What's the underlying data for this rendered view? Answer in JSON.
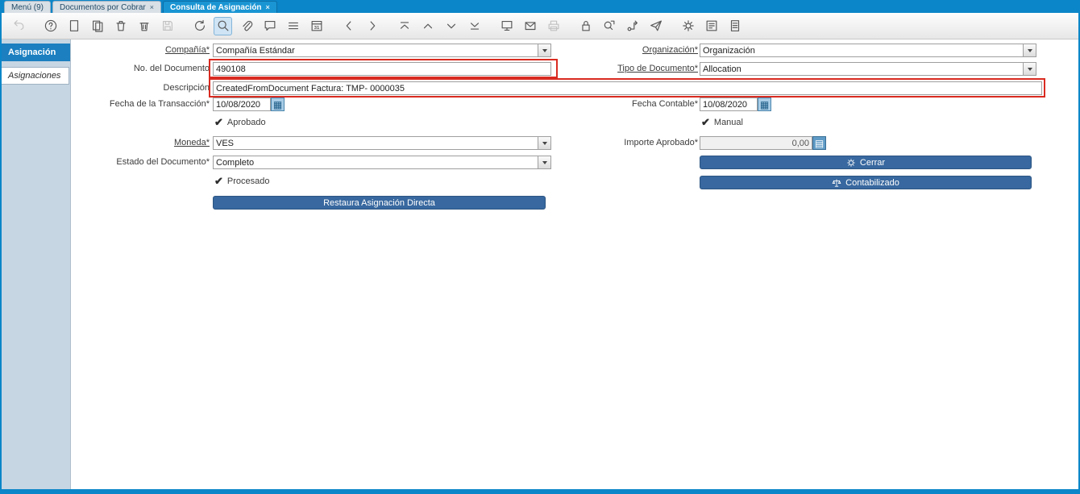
{
  "tabbar": {
    "tabs": [
      {
        "label": "Menú (9)"
      },
      {
        "label": "Documentos por Cobrar"
      },
      {
        "label": "Consulta de Asignación"
      }
    ],
    "close_glyph": "×"
  },
  "toolbar": {
    "icons": [
      "undo",
      "help",
      "new-record",
      "copy-record",
      "delete-record",
      "delete-selection",
      "save",
      "refresh",
      "find",
      "attachment",
      "chat",
      "grid-toggle",
      "calendar",
      "previous-tab",
      "next-tab",
      "first-record",
      "previous-record",
      "next-record",
      "last-record",
      "requests",
      "archive",
      "print",
      "private-record-lock",
      "zoom-across",
      "workflow",
      "send-mail",
      "preferences",
      "export",
      "report"
    ],
    "calendar_number": "31"
  },
  "sidebar": {
    "tabs": [
      {
        "label": "Asignación"
      },
      {
        "label": "Asignaciones"
      }
    ]
  },
  "form": {
    "company": {
      "label": "Compañía*",
      "value": "Compañía Estándar"
    },
    "organization": {
      "label": "Organización*",
      "value": "Organización"
    },
    "document_no": {
      "label": "No. del Documento",
      "value": "490108"
    },
    "document_type": {
      "label": "Tipo de Documento*",
      "value": "Allocation"
    },
    "description": {
      "label": "Descripción",
      "value": "CreatedFromDocument Factura: TMP- 0000035"
    },
    "transaction_date": {
      "label": "Fecha de la Transacción*",
      "value": "10/08/2020"
    },
    "accounting_date": {
      "label": "Fecha Contable*",
      "value": "10/08/2020"
    },
    "approved": {
      "label": "Aprobado",
      "checked": true
    },
    "manual": {
      "label": "Manual",
      "checked": true
    },
    "currency": {
      "label": "Moneda*",
      "value": "VES"
    },
    "approved_amount": {
      "label": "Importe Aprobado*",
      "value": "0,00"
    },
    "document_status": {
      "label": "Estado del Documento*",
      "value": "Completo"
    },
    "processed": {
      "label": "Procesado",
      "checked": true
    },
    "buttons": {
      "close": "Cerrar",
      "posted": "Contabilizado",
      "restore": "Restaura Asignación Directa"
    },
    "check_glyph": "✔",
    "calendar_button_glyph": "▦",
    "calculator_button_glyph": "▤"
  },
  "colors": {
    "accent_blue": "#0b86c8",
    "active_tab_blue": "#1a95d3",
    "sidebar_tab_blue": "#1b7fc0",
    "button_blue": "#38689f",
    "highlight_red": "#d92b21"
  }
}
